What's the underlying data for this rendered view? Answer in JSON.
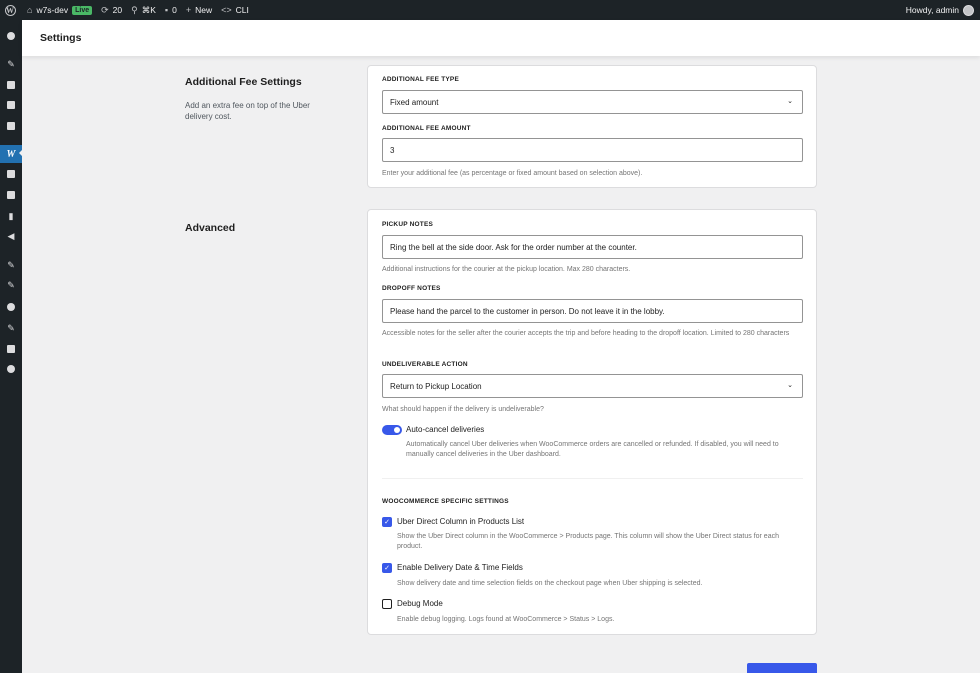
{
  "adminbar": {
    "site_name": "w7s-dev",
    "live_badge": "Live",
    "updates_count": "20",
    "command_shortcut": "⌘K",
    "comments_count": "0",
    "new_label": "New",
    "cli_label": "CLI",
    "howdy": "Howdy, admin",
    "icons": [
      "wordpress-icon",
      "home-icon",
      "updates-icon",
      "search-icon",
      "comments-icon",
      "plus-icon",
      "code-icon",
      "avatar"
    ]
  },
  "sidebar": {
    "icons": [
      "dashboard-icon",
      "pin-icon",
      "media-icon",
      "pages-icon",
      "comments-icon",
      "woocommerce-icon",
      "products-icon",
      "payments-icon",
      "analytics-icon",
      "marketing-icon",
      "appearance-icon",
      "plugins-icon",
      "users-icon",
      "tools-icon",
      "settings-icon",
      "play-icon"
    ],
    "active_label": "W"
  },
  "header": {
    "title": "Settings"
  },
  "sections": {
    "fee": {
      "title": "Additional Fee Settings",
      "description": "Add an extra fee on top of the Uber delivery cost.",
      "type_label": "ADDITIONAL FEE TYPE",
      "type_value": "Fixed amount",
      "amount_label": "ADDITIONAL FEE AMOUNT",
      "amount_value": "3",
      "amount_help": "Enter your additional fee (as percentage or fixed amount based on selection above)."
    },
    "advanced": {
      "title": "Advanced",
      "pickup_label": "PICKUP NOTES",
      "pickup_value": "Ring the bell at the side door. Ask for the order number at the counter.",
      "pickup_help": "Additional instructions for the courier at the pickup location. Max 280 characters.",
      "dropoff_label": "DROPOFF NOTES",
      "dropoff_value": "Please hand the parcel to the customer in person. Do not leave it in the lobby.",
      "dropoff_help": "Accessible notes for the seller after the courier accepts the trip and before heading to the dropoff location. Limited to 280 characters",
      "undeliverable_label": "UNDELIVERABLE ACTION",
      "undeliverable_value": "Return to Pickup Location",
      "undeliverable_help": "What should happen if the delivery is undeliverable?",
      "autocancel_label": "Auto-cancel deliveries",
      "autocancel_help": "Automatically cancel Uber deliveries when WooCommerce orders are cancelled or refunded. If disabled, you will need to manually cancel deliveries in the Uber dashboard.",
      "autocancel_on": true,
      "woo_heading": "WOOCOMMERCE SPECIFIC SETTINGS",
      "opt1_label": "Uber Direct Column in Products List",
      "opt1_help": "Show the Uber Direct column in the WooCommerce > Products page. This column will show the Uber Direct status for each product.",
      "opt1_checked": true,
      "opt2_label": "Enable Delivery Date & Time Fields",
      "opt2_help": "Show delivery date and time selection fields on the checkout page when Uber shipping is selected.",
      "opt2_checked": true,
      "opt3_label": "Debug Mode",
      "opt3_help": "Enable debug logging. Logs found at WooCommerce > Status > Logs.",
      "opt3_checked": false
    }
  },
  "colors": {
    "adminbar": "#1d2327",
    "accent": "#3858e9",
    "wp_blue": "#2271b1",
    "live": "#4ab866"
  }
}
